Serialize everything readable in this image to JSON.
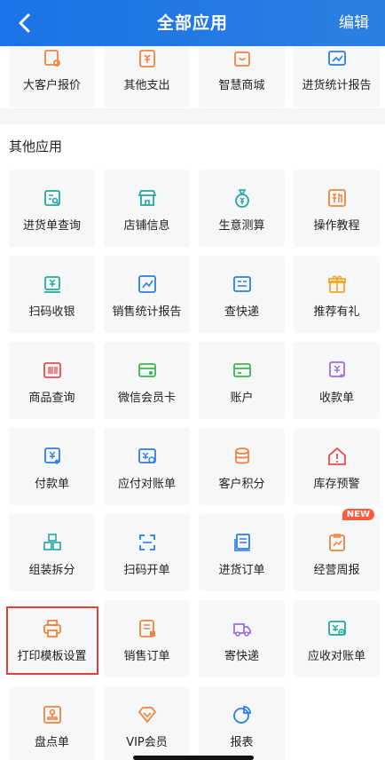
{
  "header": {
    "title": "全部应用",
    "edit_label": "编辑"
  },
  "top_apps": [
    {
      "label": "大客户报价",
      "icon": "price-tag-icon",
      "color": "#f0843c"
    },
    {
      "label": "其他支出",
      "icon": "yuan-list-icon",
      "color": "#f0843c"
    },
    {
      "label": "智慧商城",
      "icon": "mall-icon",
      "color": "#f0843c"
    },
    {
      "label": "进货统计报告",
      "icon": "chart-icon",
      "color": "#2b7de9"
    }
  ],
  "other_section": {
    "title": "其他应用",
    "new_badge": "NEW",
    "apps": [
      {
        "label": "进货单查询",
        "icon": "search-doc-icon",
        "color": "#21a8a0"
      },
      {
        "label": "店铺信息",
        "icon": "store-icon",
        "color": "#21a8a0"
      },
      {
        "label": "生意测算",
        "icon": "money-bag-icon",
        "color": "#21a8a0"
      },
      {
        "label": "操作教程",
        "icon": "new-tutorial-icon",
        "color": "#f0843c"
      },
      {
        "label": "扫码收银",
        "icon": "cash-scan-icon",
        "color": "#21a8a0"
      },
      {
        "label": "销售统计报告",
        "icon": "trend-chart-icon",
        "color": "#2b7de9"
      },
      {
        "label": "查快递",
        "icon": "express-query-icon",
        "color": "#2b7de9"
      },
      {
        "label": "推荐有礼",
        "icon": "gift-icon",
        "color": "#f5a623"
      },
      {
        "label": "商品查询",
        "icon": "barcode-icon",
        "color": "#e84c4c"
      },
      {
        "label": "微信会员卡",
        "icon": "wechat-card-icon",
        "color": "#3cb54a"
      },
      {
        "label": "账户",
        "icon": "card-icon",
        "color": "#3cb54a"
      },
      {
        "label": "收款单",
        "icon": "receipt-in-icon",
        "color": "#9b6ee0"
      },
      {
        "label": "付款单",
        "icon": "payment-out-icon",
        "color": "#2b7de9"
      },
      {
        "label": "应付对账单",
        "icon": "payable-statement-icon",
        "color": "#2b7de9"
      },
      {
        "label": "客户积分",
        "icon": "coins-icon",
        "color": "#f0843c"
      },
      {
        "label": "库存预警",
        "icon": "warning-house-icon",
        "color": "#e84c4c"
      },
      {
        "label": "组装拆分",
        "icon": "cubes-icon",
        "color": "#21a8a0"
      },
      {
        "label": "扫码开单",
        "icon": "scan-frame-icon",
        "color": "#2b7de9"
      },
      {
        "label": "进货订单",
        "icon": "purchase-order-icon",
        "color": "#2b7de9"
      },
      {
        "label": "经营周报",
        "icon": "weekly-report-icon",
        "color": "#f0843c"
      },
      {
        "label": "打印模板设置",
        "icon": "printer-icon",
        "color": "#f0843c"
      },
      {
        "label": "销售订单",
        "icon": "sales-order-icon",
        "color": "#f0843c"
      },
      {
        "label": "寄快递",
        "icon": "truck-icon",
        "color": "#9b6ee0"
      },
      {
        "label": "应收对账单",
        "icon": "receivable-statement-icon",
        "color": "#21a8a0"
      },
      {
        "label": "盘点单",
        "icon": "stamp-icon",
        "color": "#f0843c"
      },
      {
        "label": "VIP会员",
        "icon": "vip-diamond-icon",
        "color": "#f0843c"
      },
      {
        "label": "报表",
        "icon": "pie-chart-icon",
        "color": "#2b7de9"
      }
    ]
  }
}
